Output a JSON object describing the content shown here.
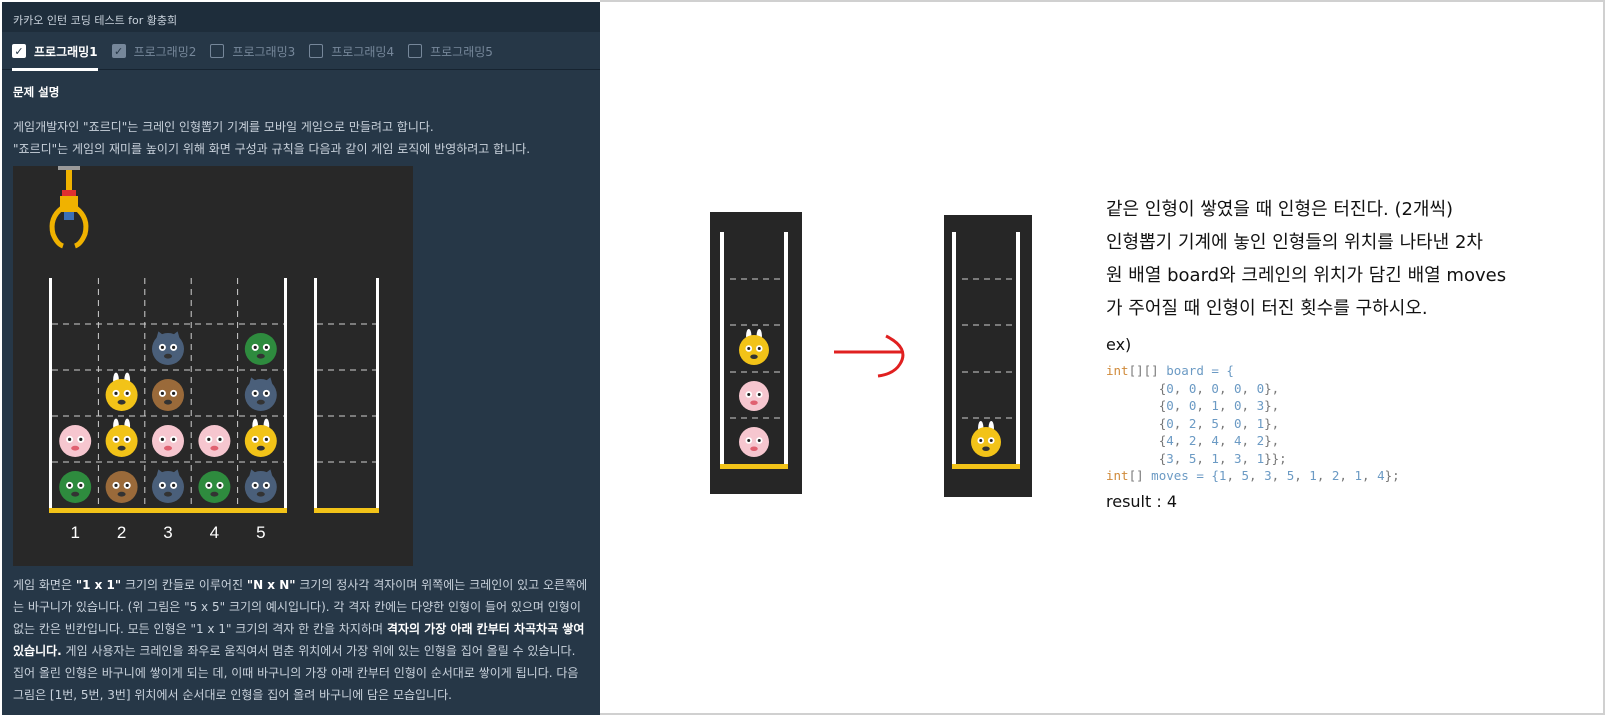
{
  "window": {
    "title": "카카오 인턴 코딩 테스트 for 황충희"
  },
  "tabs": [
    {
      "label": "프로그래밍1",
      "state": "active"
    },
    {
      "label": "프로그래밍2",
      "state": "checked"
    },
    {
      "label": "프로그래밍3",
      "state": "unchecked"
    },
    {
      "label": "프로그래밍4",
      "state": "unchecked"
    },
    {
      "label": "프로그래밍5",
      "state": "unchecked"
    }
  ],
  "problem": {
    "heading": "문제 설명",
    "intro_lines": [
      "게임개발자인 \"죠르디\"는 크레인 인형뽑기 기계를 모바일 게임으로 만들려고 합니다.",
      "\"죠르디\"는 게임의 재미를 높이기 위해 화면 구성과 규칙을 다음과 같이 게임 로직에 반영하려고 합니다."
    ],
    "board_columns": [
      "1",
      "2",
      "3",
      "4",
      "5"
    ],
    "board": [
      [
        0,
        0,
        0,
        0,
        0
      ],
      [
        0,
        0,
        1,
        0,
        3
      ],
      [
        0,
        2,
        5,
        0,
        1
      ],
      [
        4,
        2,
        4,
        4,
        2
      ],
      [
        3,
        5,
        1,
        3,
        1
      ]
    ],
    "doll_colors": {
      "1": "#4a5f7a",
      "2": "#f2c318",
      "3": "#2e8b3e",
      "4": "#f6c6cf",
      "5": "#9a6a3a"
    },
    "description_parts": [
      {
        "text": "게임 화면은 ",
        "bold": false
      },
      {
        "text": "\"1 x 1\"",
        "bold": true
      },
      {
        "text": " 크기의 칸들로 이루어진 ",
        "bold": false
      },
      {
        "text": "\"N x N\"",
        "bold": true
      },
      {
        "text": " 크기의 정사각 격자이며 위쪽에는 크레인이 있고 오른쪽에는 바구니가 있습니다. (위 그림은 \"5 x 5\" 크기의 예시입니다). 각 격자 칸에는 다양한 인형이 들어 있으며 인형이 없는 칸은 빈칸입니다. 모든 인형은 \"1 x 1\" 크기의 격자 한 칸을 차지하며 ",
        "bold": false
      },
      {
        "text": "격자의 가장 아래 칸부터 차곡차곡 쌓여 있습니다.",
        "bold": true
      },
      {
        "text": " 게임 사용자는 크레인을 좌우로 움직여서 멈춘 위치에서 가장 위에 있는 인형을 집어 올릴 수 있습니다. 집어 올린 인형은 바구니에 쌓이게 되는 데, 이때 바구니의 가장 아래 칸부터 인형이 순서대로 쌓이게 됩니다. 다음 그림은 [1번, 5번, 3번] 위치에서 순서대로 인형을 집어 올려 바구니에 담은 모습입니다.",
        "bold": false
      }
    ]
  },
  "note": {
    "lines": [
      "같은 인형이 쌓였을 때 인형은 터진다. (2개씩)",
      "인형뽑기 기계에 놓인 인형들의 위치를 나타낸 2차",
      "원 배열 board와 크레인의 위치가 담긴 배열 moves",
      "가 주어질 때 인형이 터진 횟수를 구하시오."
    ],
    "example_label": "ex)",
    "code": {
      "board_decl_type": "int",
      "board_decl_brackets": "[][]",
      "board_decl_rest": " board = {",
      "board_rows": [
        [
          0,
          0,
          0,
          0,
          0
        ],
        [
          0,
          0,
          1,
          0,
          3
        ],
        [
          0,
          2,
          5,
          0,
          1
        ],
        [
          4,
          2,
          4,
          4,
          2
        ],
        [
          3,
          5,
          1,
          3,
          1
        ]
      ],
      "moves_decl_type": "int",
      "moves_decl_brackets": "[]",
      "moves_decl_rest": " moves = {",
      "moves": [
        1,
        5,
        3,
        5,
        1,
        2,
        1,
        4
      ]
    },
    "result_text": "result : 4",
    "before_basket": [
      4,
      4,
      2
    ],
    "after_basket": [
      2
    ]
  }
}
